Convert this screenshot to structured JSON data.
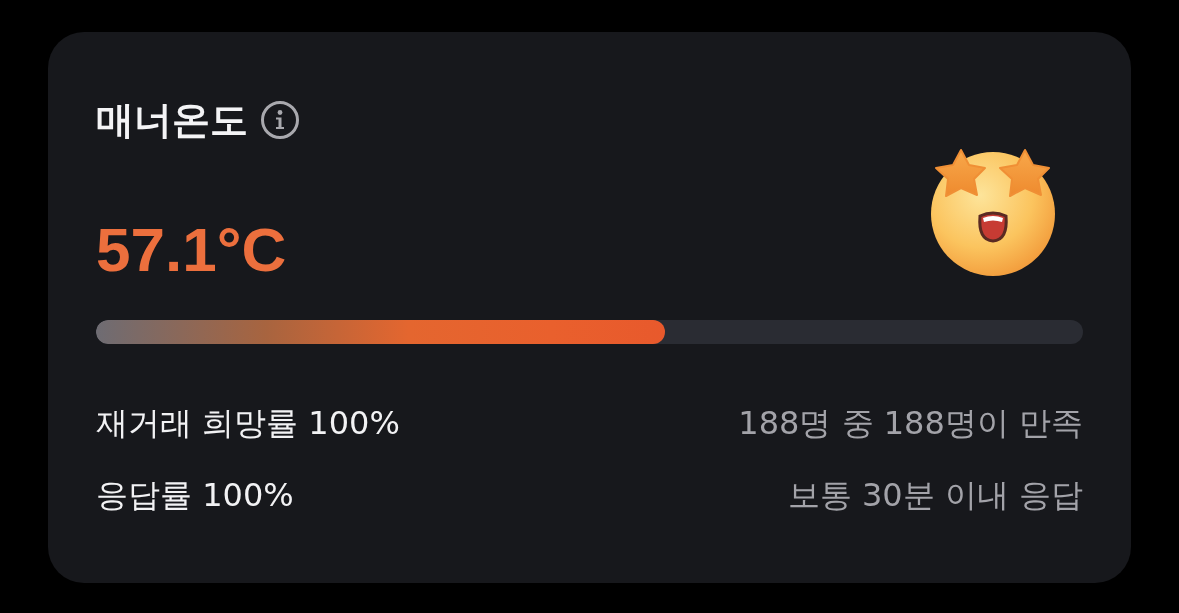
{
  "card": {
    "title": "매너온도",
    "temperature": "57.1°C",
    "meter": {
      "level": 0.577
    },
    "stats": [
      {
        "label": "재거래 희망률 100%",
        "detail": "188명 중 188명이 만족"
      },
      {
        "label": "응답률 100%",
        "detail": "보통 30분 이내 응답"
      }
    ]
  }
}
